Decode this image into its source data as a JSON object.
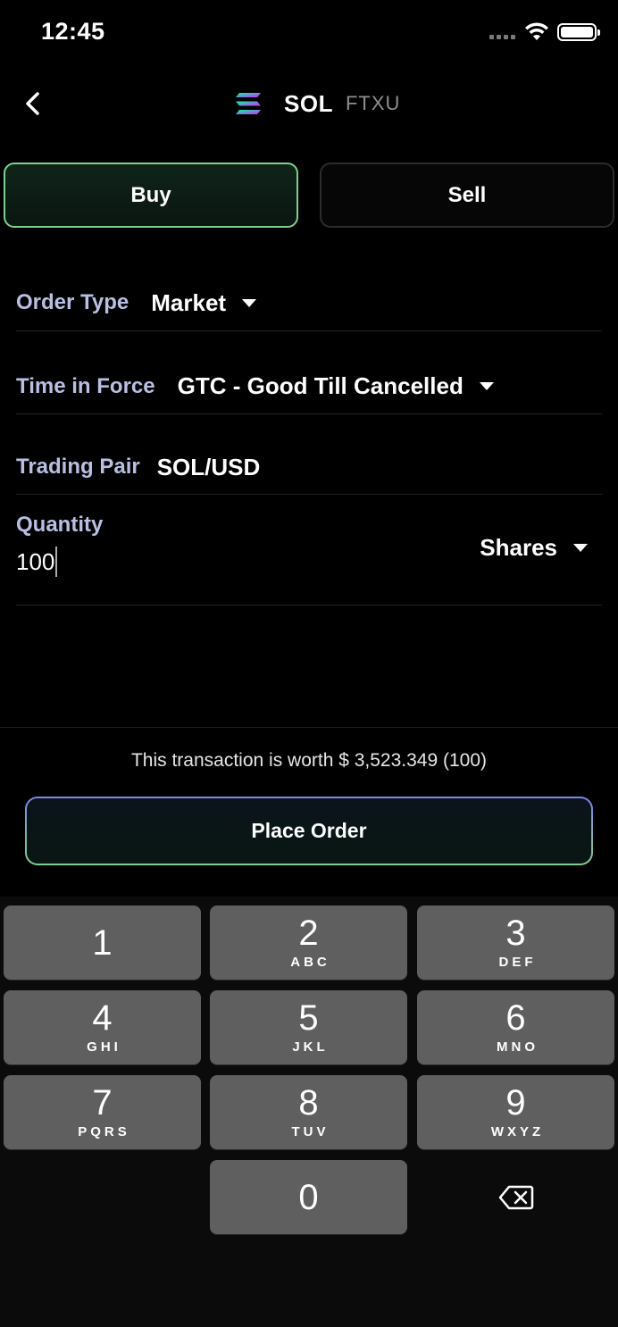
{
  "status_bar": {
    "time": "12:45"
  },
  "header": {
    "title": "SOL",
    "subtitle": "FTXU"
  },
  "side_toggle": {
    "buy_label": "Buy",
    "sell_label": "Sell",
    "selected": "Buy"
  },
  "form": {
    "order_type": {
      "label": "Order Type",
      "value": "Market"
    },
    "time_in_force": {
      "label": "Time in Force",
      "value": "GTC - Good Till Cancelled"
    },
    "trading_pair": {
      "label": "Trading Pair",
      "value": "SOL/USD"
    },
    "quantity": {
      "label": "Quantity",
      "value": "100",
      "unit": "Shares"
    }
  },
  "summary": {
    "worth_text": "This transaction is worth $ 3,523.349 (100)"
  },
  "actions": {
    "place_order_label": "Place Order"
  },
  "keypad": {
    "keys": [
      {
        "num": "1",
        "letters": ""
      },
      {
        "num": "2",
        "letters": "ABC"
      },
      {
        "num": "3",
        "letters": "DEF"
      },
      {
        "num": "4",
        "letters": "GHI"
      },
      {
        "num": "5",
        "letters": "JKL"
      },
      {
        "num": "6",
        "letters": "MNO"
      },
      {
        "num": "7",
        "letters": "PQRS"
      },
      {
        "num": "8",
        "letters": "TUV"
      },
      {
        "num": "9",
        "letters": "WXYZ"
      },
      {
        "num": "0",
        "letters": ""
      }
    ]
  },
  "colors": {
    "accent_green": "#7fd08f",
    "accent_purple": "#7b83e8",
    "label": "#b9bfe2",
    "key_bg": "#5f5f5f"
  }
}
